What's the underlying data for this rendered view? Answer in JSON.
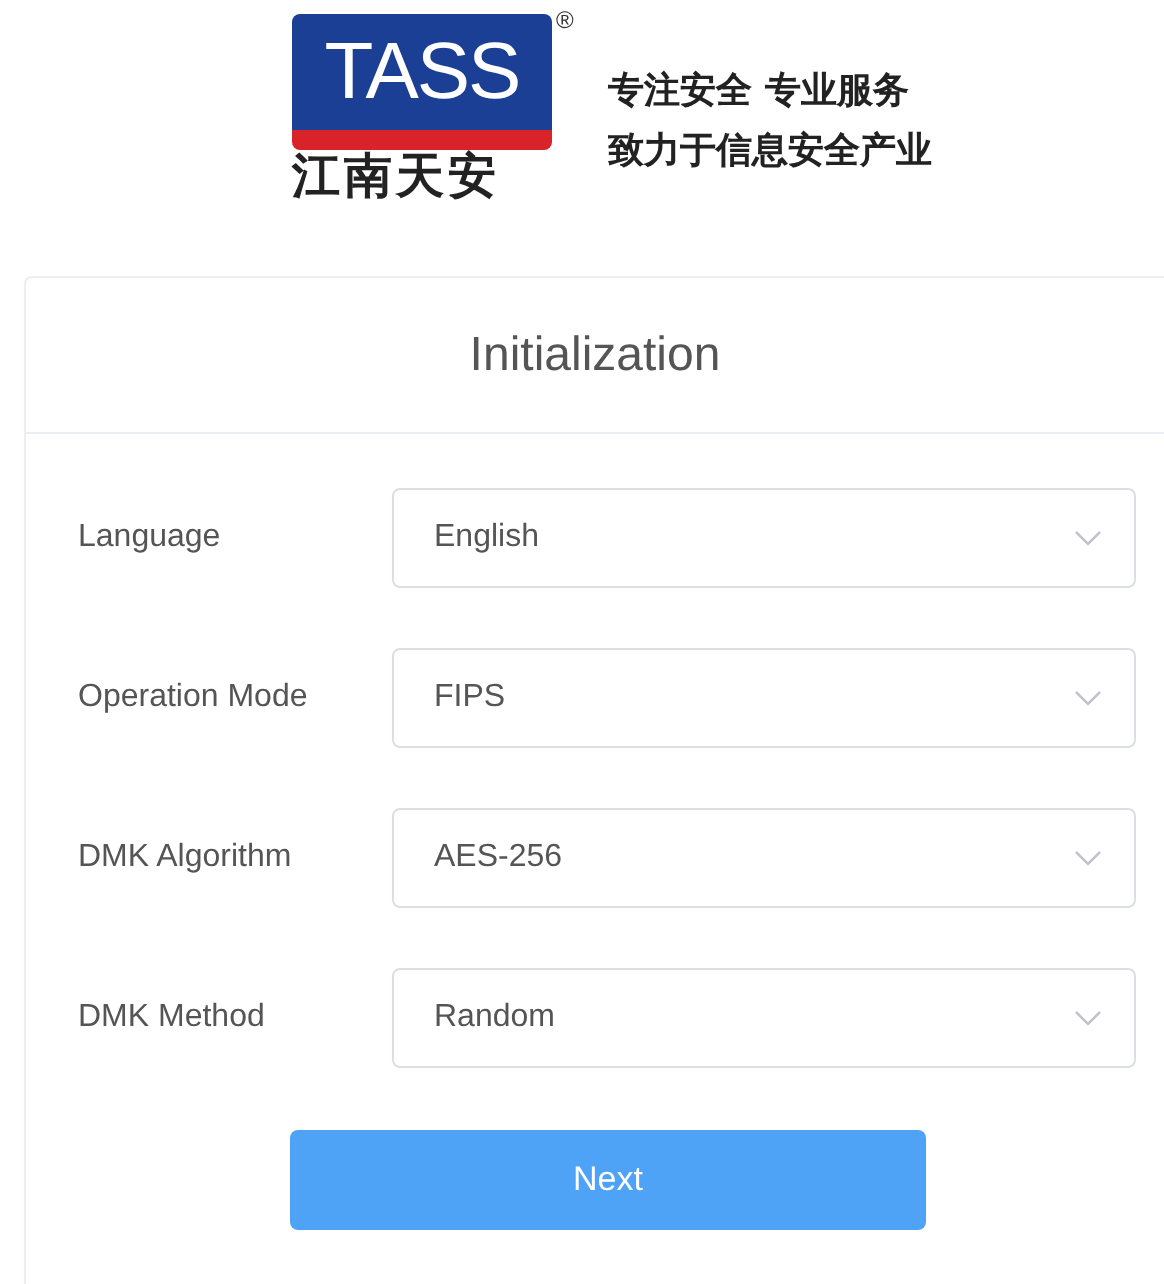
{
  "logo": {
    "wordmark": "TASS",
    "registered": "®",
    "chinese_name": "江南天安",
    "slogan": [
      "专注安全 专业服务",
      "致力于信息安全产业"
    ]
  },
  "card": {
    "title": "Initialization",
    "fields": [
      {
        "label": "Language",
        "value": "English"
      },
      {
        "label": "Operation Mode",
        "value": "FIPS"
      },
      {
        "label": "DMK Algorithm",
        "value": "AES-256"
      },
      {
        "label": "DMK Method",
        "value": "Random"
      }
    ],
    "button": "Next"
  }
}
